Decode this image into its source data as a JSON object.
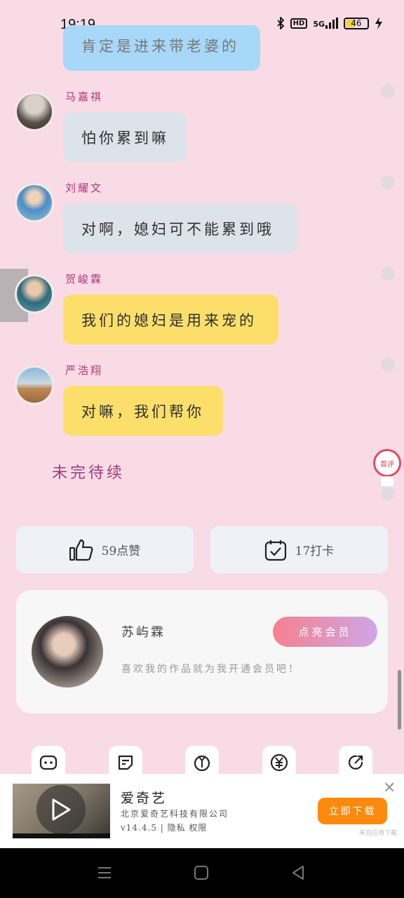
{
  "status_bar": {
    "time": "19:19",
    "network": "5G",
    "hd_label": "HD",
    "battery": "46"
  },
  "chat": [
    {
      "speaker": "",
      "text": "肯定是进来带老婆的",
      "color": "blue",
      "avatar": "avatar-0"
    },
    {
      "speaker": "马嘉祺",
      "text": "怕你累到嘛",
      "color": "gray",
      "avatar": "avatar-1"
    },
    {
      "speaker": "刘耀文",
      "text": "对啊，媳妇可不能累到哦",
      "color": "gray",
      "avatar": "avatar-2"
    },
    {
      "speaker": "贺峻霖",
      "text": "我们的媳妇是用来宠的",
      "color": "yellow",
      "avatar": "avatar-3"
    },
    {
      "speaker": "严浩翔",
      "text": "对嘛，我们帮你",
      "color": "yellow",
      "avatar": "avatar-4"
    }
  ],
  "to_be_continued": "未完待续",
  "comment_pin": {
    "label": "首评"
  },
  "actions": {
    "like_label": "59点赞",
    "checkin_label": "17打卡"
  },
  "author": {
    "name": "苏屿霖",
    "vip_button": "点亮会员",
    "description": "喜欢我的作品就为我开通会员吧！"
  },
  "toolbar": [
    "chat-icon",
    "note-icon",
    "flower-icon",
    "yuan-icon",
    "share-icon"
  ],
  "ad": {
    "title": "爱奇艺",
    "company": "北京爱奇艺科技有限公司",
    "meta": "v14.4.5 | 隐私 权限",
    "cta": "立即下载",
    "close": "✕",
    "source": "来自应用下载"
  },
  "colors": {
    "background": "#f9dbe5",
    "bubble_blue": "#a8d8f8",
    "bubble_gray": "#dde3ea",
    "bubble_yellow": "#fcdf6a",
    "speaker": "#b0347a",
    "cta": "#fb8a0e"
  }
}
